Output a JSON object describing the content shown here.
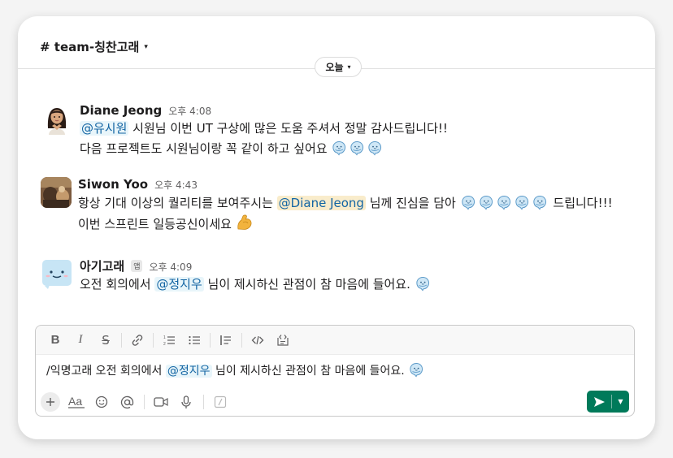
{
  "channel": {
    "name": "# team-칭찬고래"
  },
  "date_divider": {
    "label": "오늘"
  },
  "messages": [
    {
      "author": "Diane Jeong",
      "time": "오후 4:08",
      "line1": {
        "mention": "@유시원",
        "text": " 시원님 이번 UT 구상에 많은 도움 주셔서 정말 감사드립니다!!"
      },
      "line2": {
        "text": "다음 프로젝트도 시원님이랑 꼭 같이 하고 싶어요 "
      },
      "emoji_count": 3
    },
    {
      "author": "Siwon Yoo",
      "time": "오후 4:43",
      "line1": {
        "text_before": "항상 기대 이상의 퀄리티를 보여주시는 ",
        "mention": "@Diane Jeong",
        "text_after": " 님께 진심을 담아 ",
        "text_end": " 드립니다!!!"
      },
      "line2": {
        "text": "이번 스프린트 일등공신이세요 "
      },
      "emoji_count": 5
    },
    {
      "author": "아기고래",
      "app_badge": "앱",
      "time": "오후 4:09",
      "line1": {
        "text_before": "오전 회의에서 ",
        "mention": "@정지우",
        "text_after": " 님이 제시하신 관점이 참 마음에 들어요. "
      }
    }
  ],
  "composer": {
    "text_before": "/익명고래 오전 회의에서 ",
    "mention": "@정지우",
    "text_after": " 님이 제시하신 관점이 참 마음에 들어요. ",
    "toolbar": [
      "bold",
      "italic",
      "strikethrough",
      "link",
      "ordered-list",
      "bulleted-list",
      "blockquote",
      "code",
      "code-block"
    ],
    "bottom": [
      "plus",
      "format",
      "emoji",
      "mention",
      "video",
      "microphone",
      "slash"
    ]
  },
  "colors": {
    "accent": "#1264a3",
    "send": "#007a5a",
    "mention_bg": "#e8f5fa",
    "mention_highlight_bg": "#f9eccb"
  }
}
